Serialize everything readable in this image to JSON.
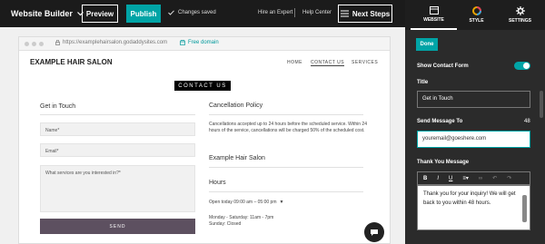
{
  "topbar": {
    "app_menu": "Website Builder",
    "preview": "Preview",
    "publish": "Publish",
    "saved": "Changes saved",
    "hire": "Hire an Expert",
    "help": "Help Center",
    "next_steps": "Next Steps"
  },
  "browser": {
    "url": "https://examplehairsalon.godaddysites.com",
    "free_domain": "Free domain"
  },
  "site": {
    "title": "EXAMPLE HAIR SALON",
    "nav": [
      "HOME",
      "CONTACT US",
      "SERVICES"
    ],
    "hero_label": "CONTACT US",
    "get_in_touch": "Get in Touch",
    "name_placeholder": "Name*",
    "email_placeholder": "Email*",
    "services_placeholder": "What services are you interested in?*",
    "send_label": "SEND",
    "cancellation_title": "Cancellation Policy",
    "cancellation_text": "Cancellations accepted up to 24 hours before the scheduled service. Within 24 hours of the service, cancellations will be charged 50% of the scheduled cost.",
    "salon_name": "Example Hair Salon",
    "hours_title": "Hours",
    "open_today": "Open today 09:00 am – 05:00 pm",
    "hours_week": "Monday - Saturday: 11am - 7pm",
    "hours_sunday": "Sunday: Closed"
  },
  "panel": {
    "tabs": [
      {
        "label": "WEBSITE",
        "icon": "layout-icon"
      },
      {
        "label": "STYLE",
        "icon": "color-wheel-icon"
      },
      {
        "label": "SETTINGS",
        "icon": "gear-icon"
      }
    ],
    "done": "Done",
    "show_contact_form": "Show Contact Form",
    "show_contact_form_on": true,
    "title_label": "Title",
    "title_value": "Get in Touch",
    "send_to_label": "Send Message To",
    "send_to_count": "48",
    "send_to_value": "youremail@goeshere.com",
    "thank_you_label": "Thank You Message",
    "thank_you_value": "Thank you for your inquiry! We will get back to you within 48 hours."
  },
  "colors": {
    "accent": "#00a4a6",
    "topbar": "#1b1b1b",
    "panel": "#2b2b2b",
    "send_button": "#5d5060"
  }
}
